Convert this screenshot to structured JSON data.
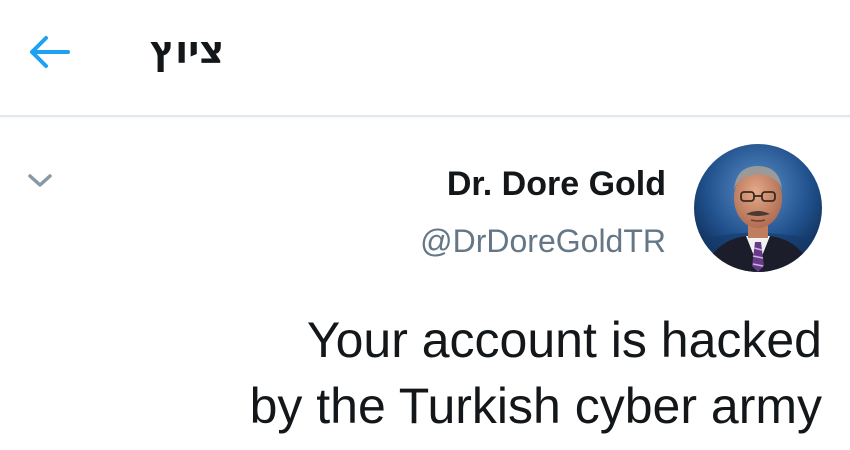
{
  "header": {
    "title": "ציוץ",
    "back_icon": "arrow-left-icon"
  },
  "tweet": {
    "author": {
      "display_name": "Dr. Dore Gold",
      "handle": "@DrDoreGoldTR",
      "avatar_icon": "profile-photo"
    },
    "menu_icon": "chevron-down-icon",
    "text_lines": [
      "Your account is hacked",
      "by the Turkish cyber army"
    ]
  },
  "colors": {
    "accent": "#1da1f2",
    "text_primary": "#14171a",
    "text_secondary": "#657786",
    "divider": "#e1e8ed"
  }
}
